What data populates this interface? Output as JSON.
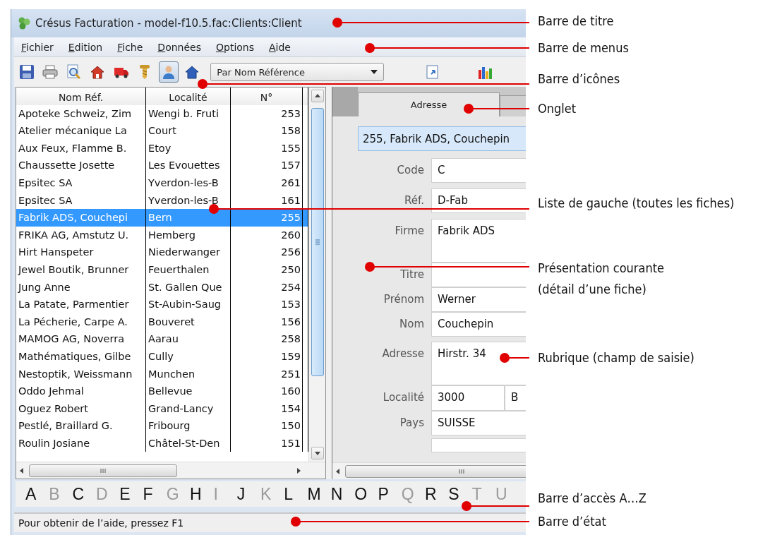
{
  "window": {
    "title": "Crésus Facturation - model-f10.5.fac:Clients:Client"
  },
  "menu": [
    "Fichier",
    "Edition",
    "Fiche",
    "Données",
    "Options",
    "Aide"
  ],
  "toolbar": {
    "icons": [
      {
        "kind": "save",
        "pressed": false
      },
      {
        "kind": "print",
        "pressed": false
      },
      {
        "kind": "preview",
        "pressed": false
      },
      {
        "kind": "house-arrow",
        "pressed": false
      },
      {
        "kind": "truck",
        "pressed": false
      },
      {
        "kind": "screw",
        "pressed": false
      },
      {
        "kind": "person",
        "pressed": true
      },
      {
        "kind": "house",
        "pressed": false
      }
    ],
    "sort_dropdown": "Par Nom Référence",
    "icons_right": [
      {
        "kind": "document",
        "pressed": false
      },
      {
        "kind": "chart",
        "pressed": false
      }
    ]
  },
  "list": {
    "columns": [
      "Nom Réf.",
      "Localité",
      "N°"
    ],
    "rows": [
      {
        "cells": [
          "Apoteke Schweiz, Zim",
          "Wengi b. Fruti",
          "253"
        ],
        "selected": false
      },
      {
        "cells": [
          "Atelier mécanique La",
          "Court",
          "158"
        ],
        "selected": false
      },
      {
        "cells": [
          "Aux Feux, Flamme B.",
          "Etoy",
          "155"
        ],
        "selected": false
      },
      {
        "cells": [
          "Chaussette Josette",
          "Les Evouettes",
          "157"
        ],
        "selected": false
      },
      {
        "cells": [
          "Epsitec SA",
          "Yverdon-les-B",
          "261"
        ],
        "selected": false
      },
      {
        "cells": [
          "Epsitec SA",
          "Yverdon-les-B",
          "161"
        ],
        "selected": false
      },
      {
        "cells": [
          "Fabrik ADS, Couchepi",
          "Bern",
          "255"
        ],
        "selected": true
      },
      {
        "cells": [
          "FRIKA AG, Amstutz U.",
          "Hemberg",
          "260"
        ],
        "selected": false
      },
      {
        "cells": [
          "Hirt Hanspeter",
          "Niederwanger",
          "256"
        ],
        "selected": false
      },
      {
        "cells": [
          "Jewel Boutik, Brunner",
          "Feuerthalen",
          "250"
        ],
        "selected": false
      },
      {
        "cells": [
          "Jung Anne",
          "St. Gallen Que",
          "254"
        ],
        "selected": false
      },
      {
        "cells": [
          "La Patate, Parmentier",
          "St-Aubin-Saug",
          "153"
        ],
        "selected": false
      },
      {
        "cells": [
          "La Pécherie, Carpe A.",
          "Bouveret",
          "156"
        ],
        "selected": false
      },
      {
        "cells": [
          "MAMOG AG, Noverra",
          "Aarau",
          "258"
        ],
        "selected": false
      },
      {
        "cells": [
          "Mathématiques, Gilbe",
          "Cully",
          "159"
        ],
        "selected": false
      },
      {
        "cells": [
          "Nestoptik, Weissmann",
          "Munchen",
          "251"
        ],
        "selected": false
      },
      {
        "cells": [
          "Oddo Jehmal",
          "Bellevue",
          "160"
        ],
        "selected": false
      },
      {
        "cells": [
          "Oguez Robert",
          "Grand-Lancy",
          "154"
        ],
        "selected": false
      },
      {
        "cells": [
          "Pestlé, Braillard G.",
          "Fribourg",
          "150"
        ],
        "selected": false
      },
      {
        "cells": [
          "Roulin Josiane",
          "Châtel-St-Den",
          "151"
        ],
        "selected": false
      }
    ]
  },
  "detail": {
    "tabs": [
      {
        "label": "Adresse",
        "selected": true
      }
    ],
    "heading": "255, Fabrik ADS, Couchepin",
    "fields": [
      {
        "kind": "line",
        "label": "Code",
        "values": [
          "C"
        ]
      },
      {
        "kind": "line",
        "label": "Réf.",
        "values": [
          "D-Fab"
        ]
      },
      {
        "kind": "multiline",
        "label": "Firme",
        "values": [
          "Fabrik ADS"
        ]
      },
      {
        "kind": "line",
        "label": "Titre"
      },
      {
        "kind": "line",
        "label": "Prénom",
        "values": [
          "Werner"
        ]
      },
      {
        "kind": "line",
        "label": "Nom",
        "values": [
          "Couchepin"
        ]
      },
      {
        "kind": "multiline",
        "label": "Adresse",
        "values": [
          "Hirstr. 34"
        ]
      },
      {
        "kind": "split",
        "label": "Localité",
        "values": [
          "3000",
          "B"
        ]
      },
      {
        "kind": "line",
        "label": "Pays",
        "values": [
          "SUISSE"
        ]
      }
    ]
  },
  "alphabet": [
    {
      "letter": "A",
      "enabled": true
    },
    {
      "letter": "B",
      "enabled": false
    },
    {
      "letter": "C",
      "enabled": true
    },
    {
      "letter": "D",
      "enabled": false
    },
    {
      "letter": "E",
      "enabled": true
    },
    {
      "letter": "F",
      "enabled": true
    },
    {
      "letter": "G",
      "enabled": false
    },
    {
      "letter": "H",
      "enabled": true
    },
    {
      "letter": "I",
      "enabled": false
    },
    {
      "letter": "J",
      "enabled": true
    },
    {
      "letter": "K",
      "enabled": false
    },
    {
      "letter": "L",
      "enabled": true
    },
    {
      "letter": "M",
      "enabled": true
    },
    {
      "letter": "N",
      "enabled": true
    },
    {
      "letter": "O",
      "enabled": true
    },
    {
      "letter": "P",
      "enabled": true
    },
    {
      "letter": "Q",
      "enabled": false
    },
    {
      "letter": "R",
      "enabled": true
    },
    {
      "letter": "S",
      "enabled": true
    },
    {
      "letter": "T",
      "enabled": false
    },
    {
      "letter": "U",
      "enabled": false
    }
  ],
  "status_bar": "Pour obtenir de l’aide, pressez F1",
  "annotations": [
    {
      "lines": [
        "Barre de titre"
      ]
    },
    {
      "lines": [
        "Barre de menus"
      ]
    },
    {
      "lines": [
        "Barre d’icônes"
      ]
    },
    {
      "lines": [
        "Onglet"
      ]
    },
    {
      "lines": [
        "Liste de gauche (toutes les fiches)"
      ]
    },
    {
      "lines": [
        "Présentation courante",
        "(détail d’une fiche)"
      ]
    },
    {
      "lines": [
        "Rubrique (champ de saisie)"
      ]
    },
    {
      "lines": [
        "Barre d’accès A…Z"
      ]
    },
    {
      "lines": [
        "Barre d’état"
      ]
    }
  ]
}
